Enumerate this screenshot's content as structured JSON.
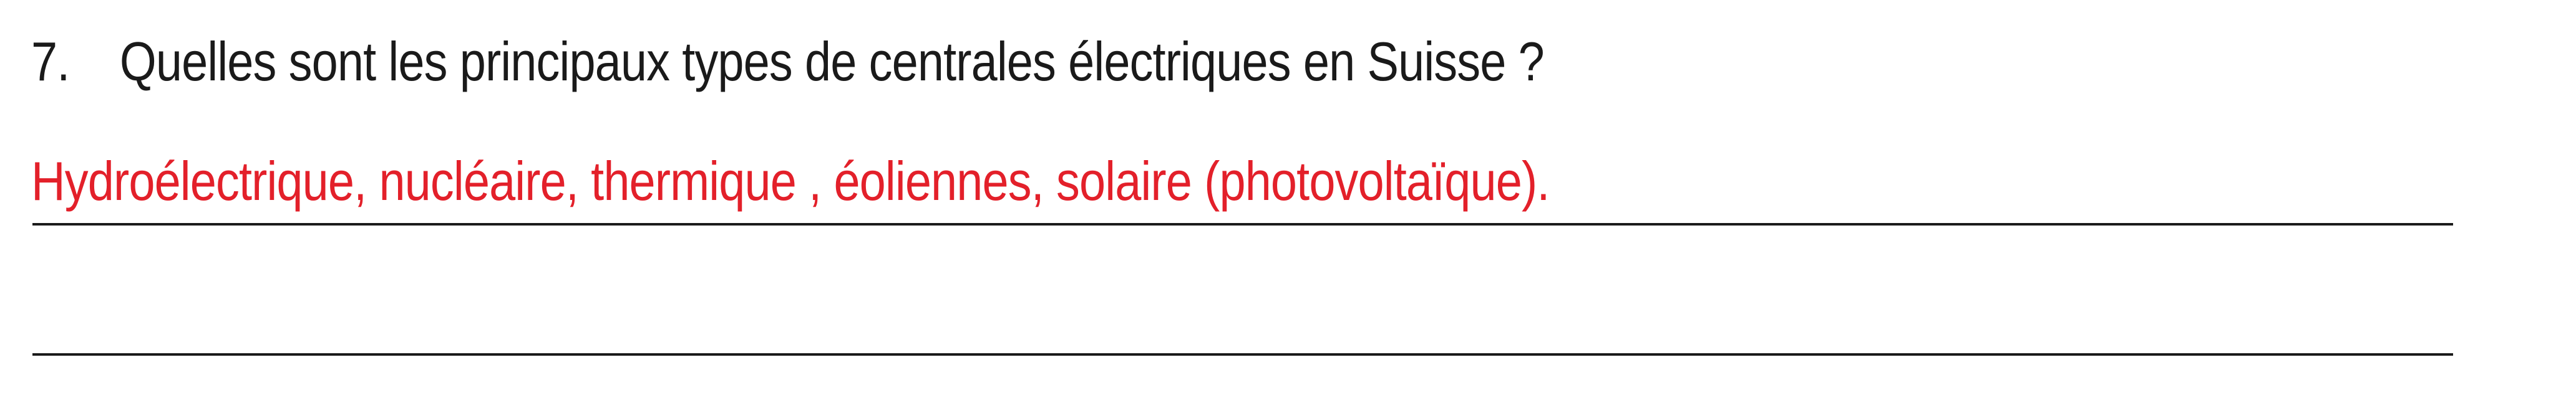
{
  "question": {
    "number": "7.",
    "text": "Quelles sont les principaux types de centrales électriques en Suisse ?"
  },
  "answer": {
    "text": "Hydroélectrique, nucléaire, thermique , éoliennes, solaire (photovoltaïque)."
  },
  "colors": {
    "question_text": "#1a1a1a",
    "answer_text": "#e3202a",
    "rules": "#1a1a1a"
  }
}
